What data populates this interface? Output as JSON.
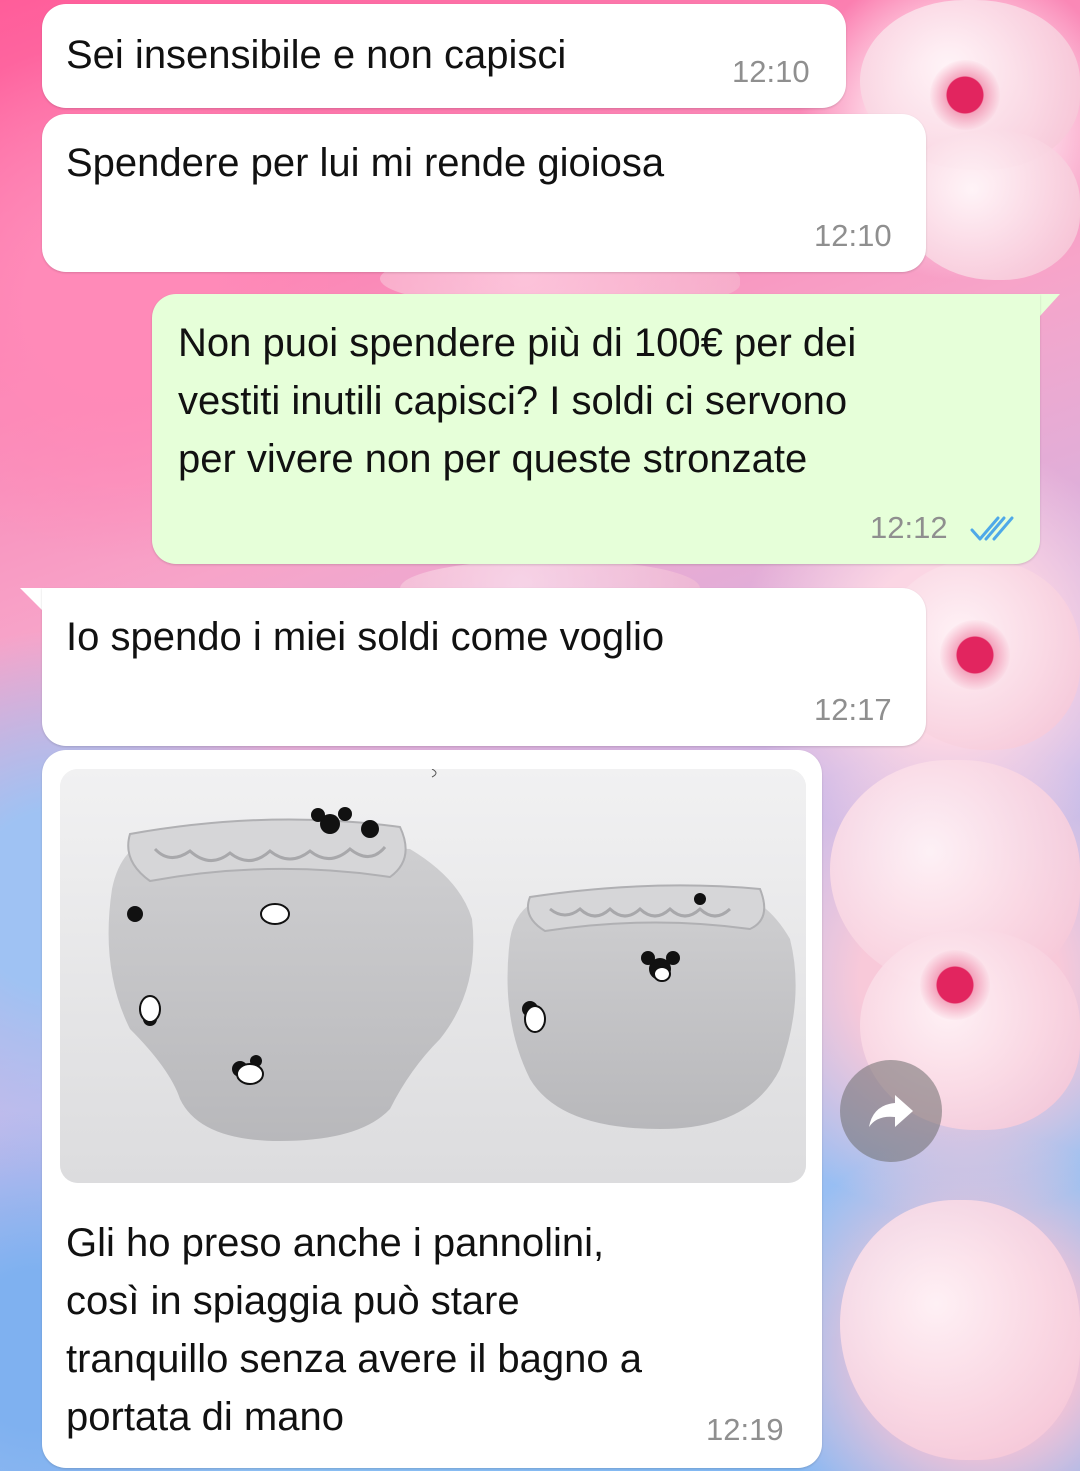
{
  "chat": {
    "messages": [
      {
        "direction": "in",
        "text": "Sei insensibile e non capisci",
        "time": "12:10"
      },
      {
        "direction": "in",
        "text": "Spendere per lui mi rende gioiosa",
        "time": "12:10"
      },
      {
        "direction": "out",
        "text": "Non puoi spendere più di 100€ per dei\nvestiti inutili capisci? I soldi ci servono\nper vivere non per queste stronzate",
        "time": "12:12",
        "status": "read"
      },
      {
        "direction": "in",
        "text": "Io spendo i miei soldi come voglio",
        "time": "12:17"
      },
      {
        "direction": "in",
        "type": "image",
        "image_subject": "two grey training pants with cartoon mouse print",
        "caption": "Gli ho preso anche i pannolini,\ncosì in spiaggia può stare\ntranquillo senza avere il bagno a\nportata di mano",
        "time": "12:19"
      }
    ]
  },
  "icons": {
    "read_receipt": "double-check-icon",
    "forward": "forward-arrow-icon"
  },
  "colors": {
    "incoming_bubble": "#ffffff",
    "outgoing_bubble": "#e6ffd9",
    "read_tick": "#4fa9e8",
    "timestamp": "#8f8f8f"
  }
}
